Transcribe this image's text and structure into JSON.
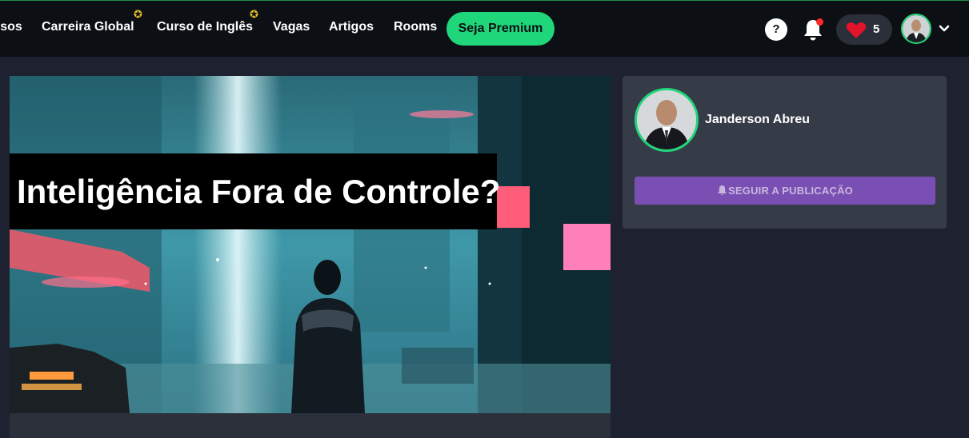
{
  "nav": {
    "items": [
      {
        "label": "rsos",
        "starred": false
      },
      {
        "label": "Carreira Global",
        "starred": true
      },
      {
        "label": "Curso de Inglês",
        "starred": true
      },
      {
        "label": "Vagas",
        "starred": false
      },
      {
        "label": "Artigos",
        "starred": false
      },
      {
        "label": "Rooms",
        "starred": false
      }
    ],
    "premium_label": "Seja Premium",
    "help_label": "?",
    "likes_count": "5",
    "star_glyph": "✪",
    "icons": [
      "help-icon",
      "bell-icon",
      "heart-icon",
      "user-avatar",
      "chevron-down-icon"
    ]
  },
  "article": {
    "hero_title": "Inteligência Fora de Controle?"
  },
  "sidebar": {
    "author_name": "Janderson Abreu",
    "follow_label": "SEGUIR A PUBLICAÇÃO"
  },
  "colors": {
    "accent_green": "#1fd67a",
    "follow_purple": "#7a4fb3",
    "notification_red": "#ff2b2b"
  }
}
